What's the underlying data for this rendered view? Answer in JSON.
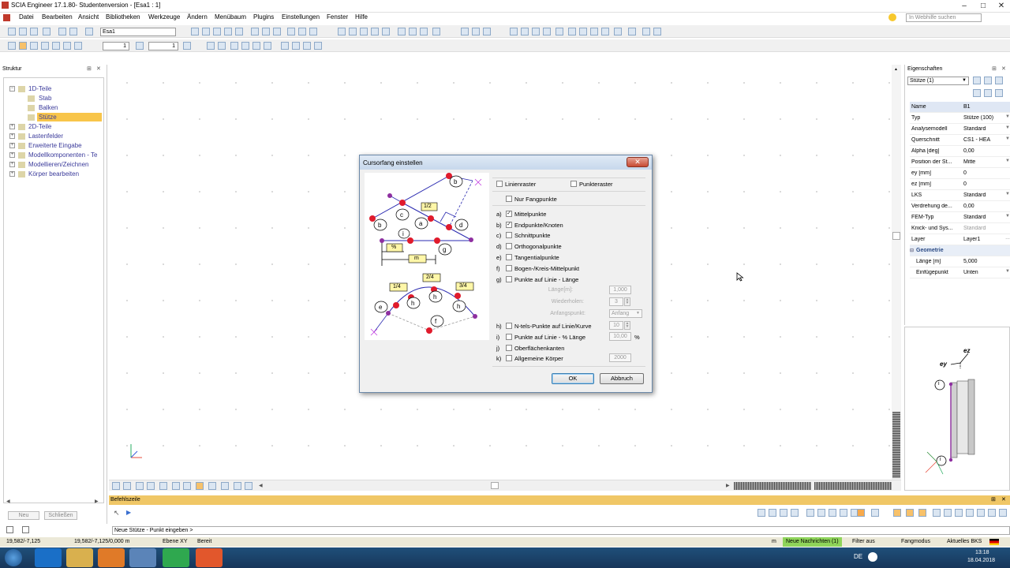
{
  "window": {
    "title": "SCIA Engineer 17.1.80- Studentenversion - [Esa1 : 1]"
  },
  "menu": {
    "items": [
      "Datei",
      "Bearbeiten",
      "Ansicht",
      "Bibliotheken",
      "Werkzeuge",
      "Ändern",
      "Menübaum",
      "Plugins",
      "Einstellungen",
      "Fenster",
      "Hilfe"
    ],
    "search_placeholder": "In Webhilfe suchen"
  },
  "toolbar": {
    "project_select": "Esa1",
    "spin1": "1",
    "spin2": "1"
  },
  "structure": {
    "title": "Struktur",
    "items": [
      {
        "label": "1D-Teile"
      },
      {
        "label": "Stab"
      },
      {
        "label": "Balken"
      },
      {
        "label": "Stütze"
      },
      {
        "label": "2D-Teile"
      },
      {
        "label": "Lastenfelder"
      },
      {
        "label": "Erweiterte Eingabe"
      },
      {
        "label": "Modellkomponenten - Te"
      },
      {
        "label": "Modellieren/Zeichnen"
      },
      {
        "label": "Körper bearbeiten"
      }
    ],
    "new_button": "Neu",
    "close_button": "Schließen"
  },
  "properties": {
    "title": "Eigenschaften",
    "selector": "Stütze (1)",
    "rows": [
      {
        "key": "Name",
        "value": "B1"
      },
      {
        "key": "Typ",
        "value": "Stütze (100)"
      },
      {
        "key": "Analysemodell",
        "value": "Standard"
      },
      {
        "key": "Querschnitt",
        "value": "CS1 - HEA"
      },
      {
        "key": "Alpha [deg]",
        "value": "0,00"
      },
      {
        "key": "Position der St...",
        "value": "Mitte"
      },
      {
        "key": "ey [mm]",
        "value": "0"
      },
      {
        "key": "ez [mm]",
        "value": "0"
      },
      {
        "key": "LKS",
        "value": "Standard"
      },
      {
        "key": "Verdrehung de...",
        "value": "0,00"
      },
      {
        "key": "FEM-Typ",
        "value": "Standard"
      },
      {
        "key": "Knick- und Sys...",
        "value": "Standard"
      },
      {
        "key": "Layer",
        "value": "Layer1"
      }
    ],
    "geometry_title": "Geometrie",
    "geometry_rows": [
      {
        "key": "Länge [m]",
        "value": "5,000"
      },
      {
        "key": "Einfügepunkt",
        "value": "Unten"
      }
    ]
  },
  "preview": {
    "label_ez": "ez",
    "label_ey": "ey",
    "label_i": "i"
  },
  "dialog": {
    "title": "Cursorfang einstellen",
    "top_checks": [
      {
        "label": "Linienraster",
        "checked": false
      },
      {
        "label": "Punkteraster",
        "checked": false
      },
      {
        "label": "Nur Fangpunkte",
        "checked": false
      }
    ],
    "options": [
      {
        "letter": "a)",
        "label": "Mittelpunkte",
        "mark": "✓"
      },
      {
        "letter": "b)",
        "label": "Endpunkte/Knoten",
        "mark": "✓"
      },
      {
        "letter": "c)",
        "label": "Schnittpunkte",
        "mark": ""
      },
      {
        "letter": "d)",
        "label": "Orthogonalpunkte",
        "mark": ""
      },
      {
        "letter": "e)",
        "label": "Tangentialpunkte",
        "mark": ""
      },
      {
        "letter": "f)",
        "label": "Bogen-/Kreis-Mittelpunkt",
        "mark": ""
      },
      {
        "letter": "g)",
        "label": "Punkte auf Linie - Länge",
        "mark": ""
      },
      {
        "letter": "h)",
        "label": "N-tels-Punkte auf Linie/Kurve",
        "mark": ""
      },
      {
        "letter": "i)",
        "label": "Punkte auf Linie - % Länge",
        "mark": ""
      },
      {
        "letter": "j)",
        "label": "Oberflächenkanten",
        "mark": ""
      },
      {
        "letter": "k)",
        "label": "Allgemeine Körper",
        "mark": ""
      }
    ],
    "laenge_label": "Länge[m]:",
    "laenge_value": "1,000",
    "wiederholen_label": "Wiederholen:",
    "wiederholen_value": "3",
    "anfang_label": "Anfangspunkt:",
    "anfang_value": "Anfang",
    "ntel_value": "10",
    "percent_value": "10,00",
    "percent_unit": "%",
    "koerper_value": "2000",
    "ok": "OK",
    "cancel": "Abbruch",
    "illus_labels": {
      "half": "1/2",
      "pct": "%",
      "m": "m",
      "q1": "1/4",
      "q2": "2/4",
      "q3": "3/4"
    }
  },
  "cmd": {
    "title": "Befehlszeile",
    "prompt": "Neue Stütze - Punkt eingeben >"
  },
  "status": {
    "coord1": "19,582/-7,125",
    "coord2": "19,582/-7,125/0,000 m",
    "plane": "Ebene XY",
    "state": "Bereit",
    "unit": "m",
    "news": "Neue Nachrichten (1)",
    "filter": "Filter aus",
    "snap": "Fangmodus",
    "lks": "Aktuelles BKS"
  },
  "taskbar": {
    "lang": "DE",
    "time": "13:18",
    "date": "18.04.2018"
  }
}
